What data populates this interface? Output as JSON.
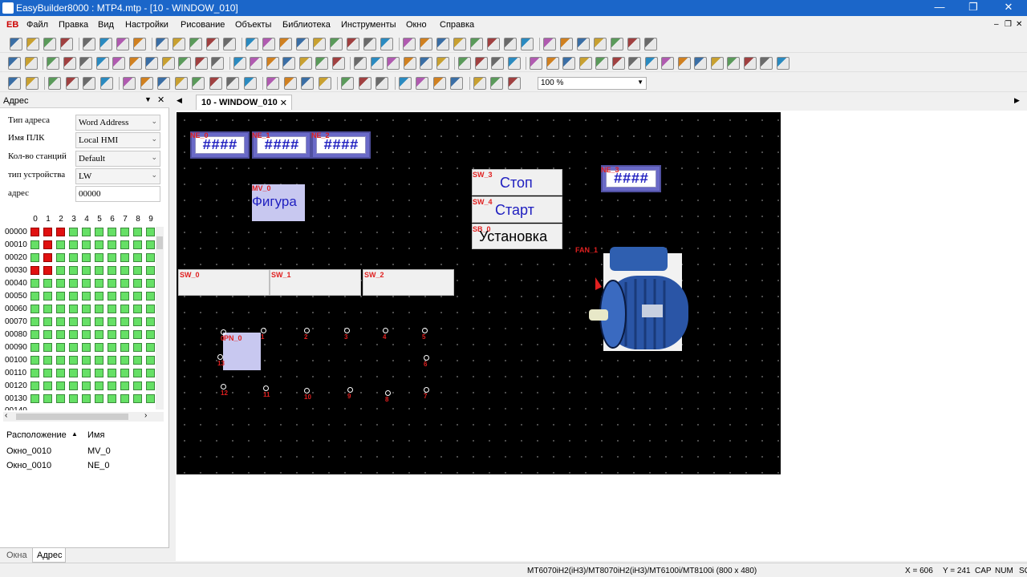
{
  "window": {
    "title": "EasyBuilder8000 : MTP4.mtp - [10 - WINDOW_010]",
    "minimize": "—",
    "maximize": "❐",
    "close": "✕"
  },
  "menu": {
    "logo": "EB",
    "items": [
      "Файл",
      "Правка",
      "Вид",
      "Настройки",
      "Рисование",
      "Объекты",
      "Библиотека",
      "Инструменты",
      "Окно",
      "Справка"
    ],
    "mdi": [
      "–",
      "❐",
      "✕"
    ]
  },
  "toolbar": {
    "zoom": "100 %"
  },
  "panel": {
    "title": "Адрес",
    "props": [
      {
        "label": "Тип адреса",
        "value": "Word Address"
      },
      {
        "label": "Имя ПЛК",
        "value": "Local HMI"
      },
      {
        "label": "Кол-во станций",
        "value": "Default"
      },
      {
        "label": "тип устройства",
        "value": "LW"
      },
      {
        "label": "адрес",
        "value": "00000"
      }
    ],
    "columns": [
      "0",
      "1",
      "2",
      "3",
      "4",
      "5",
      "6",
      "7",
      "8",
      "9"
    ],
    "rows": [
      "00000",
      "00010",
      "00020",
      "00030",
      "00040",
      "00050",
      "00060",
      "00070",
      "00080",
      "00090",
      "00100",
      "00110",
      "00120",
      "00130"
    ],
    "red_cells": [
      [
        0,
        0
      ],
      [
        0,
        1
      ],
      [
        0,
        2
      ],
      [
        1,
        1
      ],
      [
        2,
        1
      ],
      [
        3,
        0
      ],
      [
        3,
        1
      ]
    ],
    "list_headers": {
      "location": "Расположение",
      "name": "Имя"
    },
    "list_rows": [
      {
        "location": "Окно_0010",
        "name": "MV_0"
      },
      {
        "location": "Окно_0010",
        "name": "NE_0"
      }
    ],
    "bottom_tabs": [
      "Окна",
      "Адрес"
    ]
  },
  "doc_tab": {
    "label": "10 - WINDOW_010",
    "close": "✕"
  },
  "canvas": {
    "numeric_entries": [
      {
        "id": "NE_0",
        "text": "####"
      },
      {
        "id": "NE_1",
        "text": "####"
      },
      {
        "id": "NE_2",
        "text": "####"
      },
      {
        "id": "NE_3",
        "text": "####"
      }
    ],
    "mv_label": "MV_0",
    "mv_text": "Фигура",
    "switches": [
      {
        "id": "SW_3",
        "text": "Стоп"
      },
      {
        "id": "SW_4",
        "text": "Старт"
      },
      {
        "id": "SB_0",
        "text": "Установка"
      }
    ],
    "empty_switches": [
      "SW_0",
      "SW_1",
      "SW_2"
    ],
    "fan_label": "FAN_1",
    "pn_label": "PN_0",
    "points": [
      "0",
      "1",
      "2",
      "3",
      "4",
      "5",
      "6",
      "7",
      "8",
      "9",
      "10",
      "11",
      "12",
      "13"
    ]
  },
  "status": {
    "model": "MT6070iH2(iH3)/MT8070iH2(iH3)/MT6100i/MT8100i (800 x 480)",
    "x": "X = 606",
    "y": "Y = 241",
    "caps": "CAP",
    "num": "NUM",
    "scrl": "SC"
  }
}
